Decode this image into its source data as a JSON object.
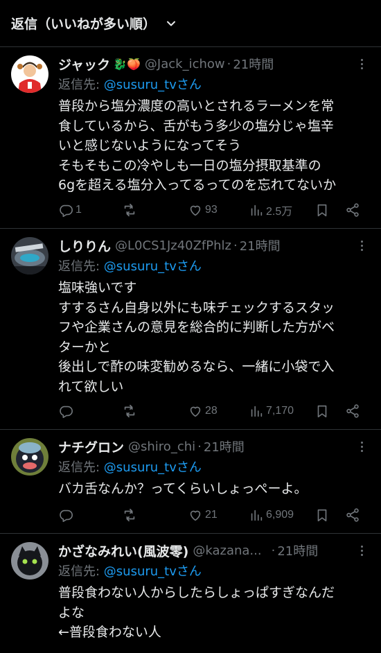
{
  "header": {
    "sort_label": "返信（いいねが多い順）"
  },
  "tweets": [
    {
      "name": "ジャック",
      "emoji": "🐉🍑",
      "handle": "@Jack_ichow",
      "time": "21時間",
      "reply_prefix": "返信先: ",
      "reply_mention": "@susuru_tvさん",
      "lines": [
        "普段から塩分濃度の高いとされるラーメンを常",
        "食しているから、舌がもう多少の塩分じゃ塩辛",
        "いと感じないようになってそう",
        "そもそもこの冷やしも一日の塩分摂取基準の",
        "6gを超える塩分入ってるってのを忘れてないか"
      ],
      "replies": "1",
      "retweets": "",
      "likes": "93",
      "views": "2.5万"
    },
    {
      "name": "しりりん",
      "emoji": "",
      "handle": "@L0CS1Jz40ZfPhlz",
      "time": "21時間",
      "reply_prefix": "返信先: ",
      "reply_mention": "@susuru_tvさん",
      "lines": [
        "塩味強いです",
        "すするさん自身以外にも味チェックするスタッ",
        "フや企業さんの意見を総合的に判断した方がベ",
        "ターかと",
        "後出しで酢の味変勧めるなら、一緒に小袋で入",
        "れて欲しい"
      ],
      "replies": "",
      "retweets": "",
      "likes": "28",
      "views": "7,170"
    },
    {
      "name": "ナチグロン",
      "emoji": "",
      "handle": "@shiro_chi",
      "time": "21時間",
      "reply_prefix": "返信先: ",
      "reply_mention": "@susuru_tvさん",
      "lines": [
        "バカ舌なんか？ってくらいしょっぺーよ。"
      ],
      "replies": "",
      "retweets": "",
      "likes": "21",
      "views": "6,909"
    },
    {
      "name": "かざなみれい(風波零)",
      "emoji": "",
      "handle": "@kazana...",
      "time": "21時間",
      "reply_prefix": "返信先: ",
      "reply_mention": "@susuru_tvさん",
      "lines": [
        "普段食わない人からしたらしょっぱすぎなんだ",
        "よな",
        "←普段食わない人"
      ]
    }
  ]
}
